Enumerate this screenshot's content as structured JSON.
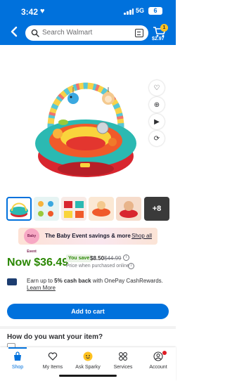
{
  "status_bar": {
    "time": "3:42",
    "network": "5G",
    "battery": "6"
  },
  "search": {
    "placeholder": "Search Walmart"
  },
  "cart": {
    "count": "1",
    "total": "$2.97"
  },
  "product_actions": [
    "heart-icon",
    "zoom-icon",
    "play-icon",
    "view-360-icon"
  ],
  "thumbnails": {
    "more_count": "+8"
  },
  "promo": {
    "logo_text": "Baby Event",
    "text": "The Baby Event savings & more",
    "link": "Shop all"
  },
  "price": {
    "now": "Now $36.49",
    "save_label": "You save",
    "save_amount": "$8.50",
    "was": "$44.99",
    "note": "Price when purchased online"
  },
  "cashback": {
    "prefix": "Earn up to ",
    "bold": "5% cash back",
    "suffix": " with OnePay CashRewards.",
    "link": "Learn More"
  },
  "add_to_cart": "Add to cart",
  "fulfillment": {
    "title": "How do you want your item?"
  },
  "nav": [
    {
      "label": "Shop",
      "icon": "shop-icon"
    },
    {
      "label": "My Items",
      "icon": "heart-icon"
    },
    {
      "label": "Ask Sparky",
      "icon": "sparky-icon"
    },
    {
      "label": "Services",
      "icon": "services-icon"
    },
    {
      "label": "Account",
      "icon": "account-icon"
    }
  ],
  "colors": {
    "brand_blue": "#0071dc",
    "price_green": "#2a8703",
    "spark_yellow": "#ffc220"
  }
}
